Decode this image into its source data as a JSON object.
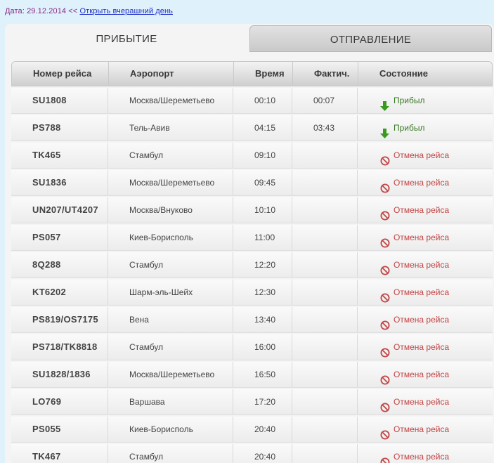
{
  "date_label": "Дата: 29.12.2014 <<",
  "yesterday_link": "Открыть вчерашний день",
  "tabs": {
    "arrival": "ПРИБЫТИЕ",
    "departure": "ОТПРАВЛЕНИЕ"
  },
  "columns": {
    "flight": "Номер рейса",
    "airport": "Аэропорт",
    "time": "Время",
    "actual": "Фактич.",
    "status": "Состояние"
  },
  "colors": {
    "arrived": "#3a9a1e",
    "cancelled": "#c24545"
  },
  "rows": [
    {
      "flight": "SU1808",
      "airport": "Москва/Шереметьево",
      "time": "00:10",
      "actual": "00:07",
      "status": "Прибыл",
      "status_type": "arrived"
    },
    {
      "flight": "PS788",
      "airport": "Тель-Авив",
      "time": "04:15",
      "actual": "03:43",
      "status": "Прибыл",
      "status_type": "arrived"
    },
    {
      "flight": "TK465",
      "airport": "Стамбул",
      "time": "09:10",
      "actual": "",
      "status": "Отмена рейса",
      "status_type": "cancelled"
    },
    {
      "flight": "SU1836",
      "airport": "Москва/Шереметьево",
      "time": "09:45",
      "actual": "",
      "status": "Отмена рейса",
      "status_type": "cancelled"
    },
    {
      "flight": "UN207/UT4207",
      "airport": "Москва/Внуково",
      "time": "10:10",
      "actual": "",
      "status": "Отмена рейса",
      "status_type": "cancelled"
    },
    {
      "flight": "PS057",
      "airport": "Киев-Борисполь",
      "time": "11:00",
      "actual": "",
      "status": "Отмена рейса",
      "status_type": "cancelled"
    },
    {
      "flight": "8Q288",
      "airport": "Стамбул",
      "time": "12:20",
      "actual": "",
      "status": "Отмена рейса",
      "status_type": "cancelled"
    },
    {
      "flight": "KT6202",
      "airport": "Шарм-эль-Шейх",
      "time": "12:30",
      "actual": "",
      "status": "Отмена рейса",
      "status_type": "cancelled"
    },
    {
      "flight": "PS819/OS7175",
      "airport": "Вена",
      "time": "13:40",
      "actual": "",
      "status": "Отмена рейса",
      "status_type": "cancelled"
    },
    {
      "flight": "PS718/TK8818",
      "airport": "Стамбул",
      "time": "16:00",
      "actual": "",
      "status": "Отмена рейса",
      "status_type": "cancelled"
    },
    {
      "flight": "SU1828/1836",
      "airport": "Москва/Шереметьево",
      "time": "16:50",
      "actual": "",
      "status": "Отмена рейса",
      "status_type": "cancelled"
    },
    {
      "flight": "LO769",
      "airport": "Варшава",
      "time": "17:20",
      "actual": "",
      "status": "Отмена рейса",
      "status_type": "cancelled"
    },
    {
      "flight": "PS055",
      "airport": "Киев-Борисполь",
      "time": "20:40",
      "actual": "",
      "status": "Отмена рейса",
      "status_type": "cancelled"
    },
    {
      "flight": "TK467",
      "airport": "Стамбул",
      "time": "20:40",
      "actual": "",
      "status": "Отмена рейса",
      "status_type": "cancelled"
    }
  ]
}
